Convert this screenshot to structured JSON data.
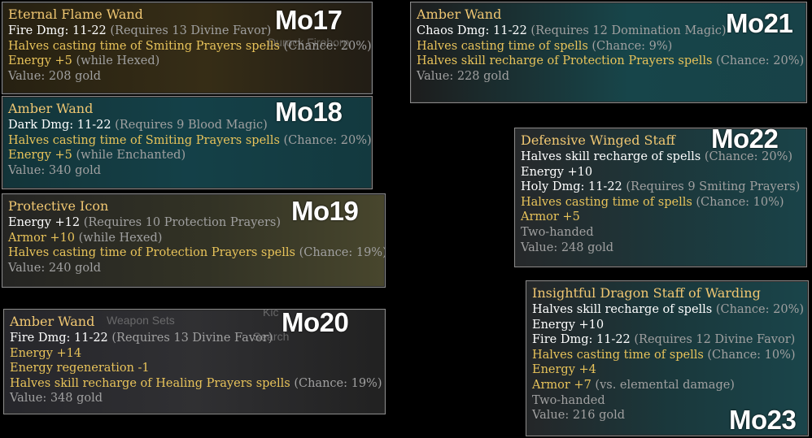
{
  "colors": {
    "title": "#f0c772",
    "mod": "#e8c35a",
    "gray": "#a0a0a0",
    "text": "#ffffff"
  },
  "background_text": {
    "durock": "Durock Fireborn",
    "weapon_sets": "Weapon Sets",
    "search": "Search",
    "kick": "Kic"
  },
  "tooltips": [
    {
      "tag": "Mo17",
      "title": "Eternal Flame Wand",
      "lines": [
        [
          {
            "t": "Fire Dmg: 11-22 ",
            "c": "white"
          },
          {
            "t": "(Requires 13 Divine Favor)",
            "c": "gray"
          }
        ],
        [
          {
            "t": "Halves casting time of Smiting Prayers spells ",
            "c": "gold"
          },
          {
            "t": "(Chance: 20%)",
            "c": "gray"
          }
        ],
        [
          {
            "t": "Energy +5 ",
            "c": "gold"
          },
          {
            "t": "(while Hexed)",
            "c": "gray"
          }
        ],
        [
          {
            "t": "Value: 208 gold",
            "c": "gray"
          }
        ]
      ]
    },
    {
      "tag": "Mo18",
      "title": "Amber Wand",
      "lines": [
        [
          {
            "t": "Dark Dmg: 11-22 ",
            "c": "white"
          },
          {
            "t": "(Requires 9 Blood Magic)",
            "c": "gray"
          }
        ],
        [
          {
            "t": "Halves casting time of Smiting Prayers spells ",
            "c": "gold"
          },
          {
            "t": "(Chance: 20%)",
            "c": "gray"
          }
        ],
        [
          {
            "t": "Energy +5 ",
            "c": "gold"
          },
          {
            "t": "(while Enchanted)",
            "c": "gray"
          }
        ],
        [
          {
            "t": "Value: 340 gold",
            "c": "gray"
          }
        ]
      ]
    },
    {
      "tag": "Mo19",
      "title": "Protective Icon",
      "lines": [
        [
          {
            "t": "Energy +12 ",
            "c": "white"
          },
          {
            "t": "(Requires 10 Protection Prayers)",
            "c": "gray"
          }
        ],
        [
          {
            "t": "Armor +10 ",
            "c": "gold"
          },
          {
            "t": "(while Hexed)",
            "c": "gray"
          }
        ],
        [
          {
            "t": "Halves casting time of Protection Prayers spells ",
            "c": "gold"
          },
          {
            "t": "(Chance: 19%)",
            "c": "gray"
          }
        ],
        [
          {
            "t": "Value: 240 gold",
            "c": "gray"
          }
        ]
      ]
    },
    {
      "tag": "Mo20",
      "title": "Amber Wand",
      "lines": [
        [
          {
            "t": "Fire Dmg: 11-22 ",
            "c": "white"
          },
          {
            "t": "(Requires 13 Divine Favor)",
            "c": "gray"
          }
        ],
        [
          {
            "t": "Energy +14",
            "c": "gold"
          }
        ],
        [
          {
            "t": "Energy regeneration -1",
            "c": "gold"
          }
        ],
        [
          {
            "t": "Halves skill recharge of Healing Prayers spells ",
            "c": "gold"
          },
          {
            "t": "(Chance: 19%)",
            "c": "gray"
          }
        ],
        [
          {
            "t": "Value: 348 gold",
            "c": "gray"
          }
        ]
      ]
    },
    {
      "tag": "Mo21",
      "title": "Amber Wand",
      "lines": [
        [
          {
            "t": "Chaos Dmg: 11-22 ",
            "c": "white"
          },
          {
            "t": "(Requires 12 Domination Magic)",
            "c": "gray"
          }
        ],
        [
          {
            "t": "Halves casting time of spells ",
            "c": "gold"
          },
          {
            "t": "(Chance: 9%)",
            "c": "gray"
          }
        ],
        [
          {
            "t": "Halves skill recharge of Protection Prayers spells ",
            "c": "gold"
          },
          {
            "t": "(Chance: 20%)",
            "c": "gray"
          }
        ],
        [
          {
            "t": "Value: 228 gold",
            "c": "gray"
          }
        ]
      ]
    },
    {
      "tag": "Mo22",
      "title": "Defensive Winged Staff",
      "lines": [
        [
          {
            "t": "Halves skill recharge of spells ",
            "c": "white"
          },
          {
            "t": "(Chance: 20%)",
            "c": "gray"
          }
        ],
        [
          {
            "t": "Energy +10",
            "c": "white"
          }
        ],
        [
          {
            "t": "Holy Dmg: 11-22 ",
            "c": "white"
          },
          {
            "t": "(Requires 9 Smiting Prayers)",
            "c": "gray"
          }
        ],
        [
          {
            "t": "Halves casting time of spells ",
            "c": "gold"
          },
          {
            "t": "(Chance: 10%)",
            "c": "gray"
          }
        ],
        [
          {
            "t": "Armor +5",
            "c": "gold"
          }
        ],
        [
          {
            "t": "Two-handed",
            "c": "gray"
          }
        ],
        [
          {
            "t": "Value: 248 gold",
            "c": "gray"
          }
        ]
      ]
    },
    {
      "tag": "Mo23",
      "title": "Insightful Dragon Staff of Warding",
      "lines": [
        [
          {
            "t": "Halves skill recharge of spells ",
            "c": "white"
          },
          {
            "t": "(Chance: 20%)",
            "c": "gray"
          }
        ],
        [
          {
            "t": "Energy +10",
            "c": "white"
          }
        ],
        [
          {
            "t": "Fire Dmg: 11-22 ",
            "c": "white"
          },
          {
            "t": "(Requires 12 Divine Favor)",
            "c": "gray"
          }
        ],
        [
          {
            "t": "Halves casting time of spells ",
            "c": "gold"
          },
          {
            "t": "(Chance: 10%)",
            "c": "gray"
          }
        ],
        [
          {
            "t": "Energy +4",
            "c": "gold"
          }
        ],
        [
          {
            "t": "Armor +7 ",
            "c": "gold"
          },
          {
            "t": "(vs. elemental damage)",
            "c": "gray"
          }
        ],
        [
          {
            "t": "Two-handed",
            "c": "gray"
          }
        ],
        [
          {
            "t": "Value: 216 gold",
            "c": "gray"
          }
        ]
      ]
    }
  ]
}
